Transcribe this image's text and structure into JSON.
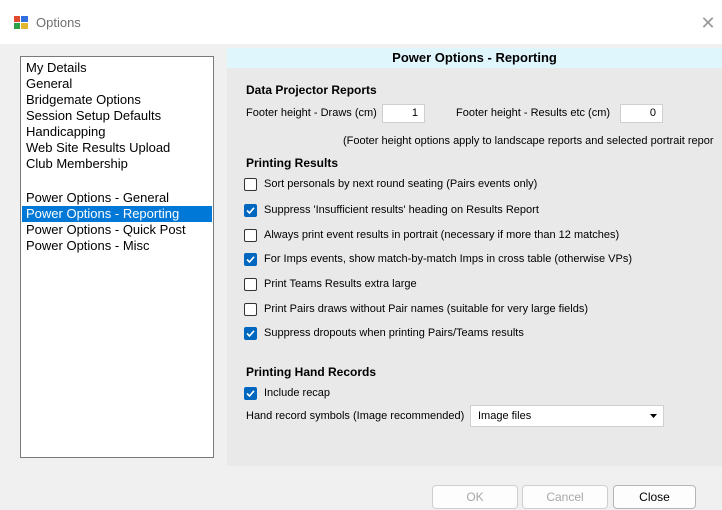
{
  "window": {
    "title": "Options"
  },
  "sidebar": {
    "items": [
      {
        "label": "My Details"
      },
      {
        "label": "General"
      },
      {
        "label": "Bridgemate Options"
      },
      {
        "label": "Session Setup Defaults"
      },
      {
        "label": "Handicapping"
      },
      {
        "label": "Web Site Results Upload"
      },
      {
        "label": "Club Membership"
      },
      {
        "label": "Power Options - General"
      },
      {
        "label": "Power Options - Reporting",
        "selected": true
      },
      {
        "label": "Power Options - Quick Post"
      },
      {
        "label": "Power Options - Misc"
      }
    ]
  },
  "panel": {
    "title": "Power Options - Reporting",
    "data_projector": {
      "heading": "Data Projector Reports",
      "footer_draws_label": "Footer height - Draws (cm)",
      "footer_draws_value": "1",
      "footer_results_label": "Footer height - Results etc (cm)",
      "footer_results_value": "0",
      "note": "(Footer height options apply to landscape reports and selected portrait repor"
    },
    "printing_results": {
      "heading": "Printing Results",
      "options": [
        {
          "label": "Sort personals by next round seating (Pairs events only)",
          "checked": false
        },
        {
          "label": "Suppress 'Insufficient results'  heading on Results Report",
          "checked": true
        },
        {
          "label": "Always print event results in portrait (necessary if more than 12 matches)",
          "checked": false
        },
        {
          "label": "For Imps events, show match-by-match Imps in cross table (otherwise VPs)",
          "checked": true
        },
        {
          "label": "Print Teams Results extra large",
          "checked": false
        },
        {
          "label": "Print Pairs draws without Pair names (suitable for very large fields)",
          "checked": false
        },
        {
          "label": "Suppress dropouts when printing Pairs/Teams results",
          "checked": true
        }
      ]
    },
    "hand_records": {
      "heading": "Printing Hand Records",
      "include_recap": {
        "label": "Include recap",
        "checked": true
      },
      "symbols_label": "Hand record symbols (Image recommended)",
      "symbols_value": "Image files"
    }
  },
  "buttons": {
    "ok": "OK",
    "cancel": "Cancel",
    "close": "Close"
  },
  "colors": {
    "accent": "#0078d7",
    "header_bg": "#dff6fd",
    "checkbox_checked": "#0067c0"
  }
}
